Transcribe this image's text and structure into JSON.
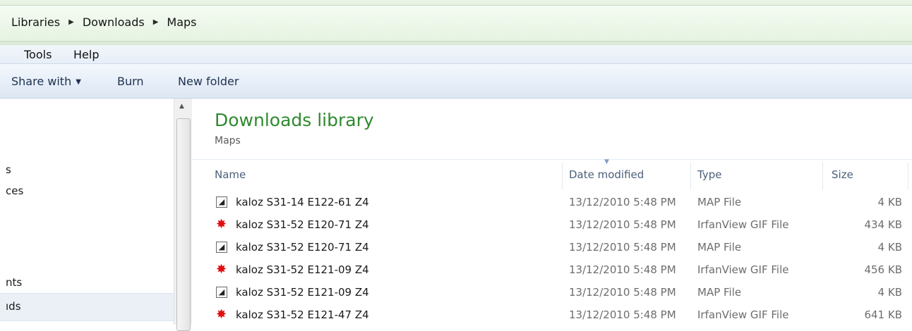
{
  "breadcrumb": [
    "Libraries",
    "Downloads",
    "Maps"
  ],
  "menu": {
    "tools": "Tools",
    "help": "Help"
  },
  "toolbar": {
    "share_with": "Share with",
    "burn": "Burn",
    "new_folder": "New folder"
  },
  "nav": {
    "items": [
      "s",
      "ces",
      "nts",
      "ıds"
    ]
  },
  "library": {
    "title": "Downloads library",
    "subtitle": "Maps"
  },
  "columns": {
    "name": "Name",
    "date": "Date modified",
    "type": "Type",
    "size": "Size"
  },
  "files": [
    {
      "name": "kaloz S31-14 E122-61 Z4",
      "date": "13/12/2010 5:48 PM",
      "type": "MAP File",
      "size": "4 KB",
      "icon": "map-file-icon"
    },
    {
      "name": "kaloz S31-52 E120-71 Z4",
      "date": "13/12/2010 5:48 PM",
      "type": "IrfanView GIF File",
      "size": "434 KB",
      "icon": "irfanview-gif-icon"
    },
    {
      "name": "kaloz S31-52 E120-71 Z4",
      "date": "13/12/2010 5:48 PM",
      "type": "MAP File",
      "size": "4 KB",
      "icon": "map-file-icon"
    },
    {
      "name": "kaloz S31-52 E121-09 Z4",
      "date": "13/12/2010 5:48 PM",
      "type": "IrfanView GIF File",
      "size": "456 KB",
      "icon": "irfanview-gif-icon"
    },
    {
      "name": "kaloz S31-52 E121-09 Z4",
      "date": "13/12/2010 5:48 PM",
      "type": "MAP File",
      "size": "4 KB",
      "icon": "map-file-icon"
    },
    {
      "name": "kaloz S31-52 E121-47 Z4",
      "date": "13/12/2010 5:48 PM",
      "type": "IrfanView GIF File",
      "size": "641 KB",
      "icon": "irfanview-gif-icon"
    }
  ],
  "colors": {
    "library_title": "#2f8a2f",
    "gif_icon": "#e01010",
    "header_text": "#4c607a"
  }
}
